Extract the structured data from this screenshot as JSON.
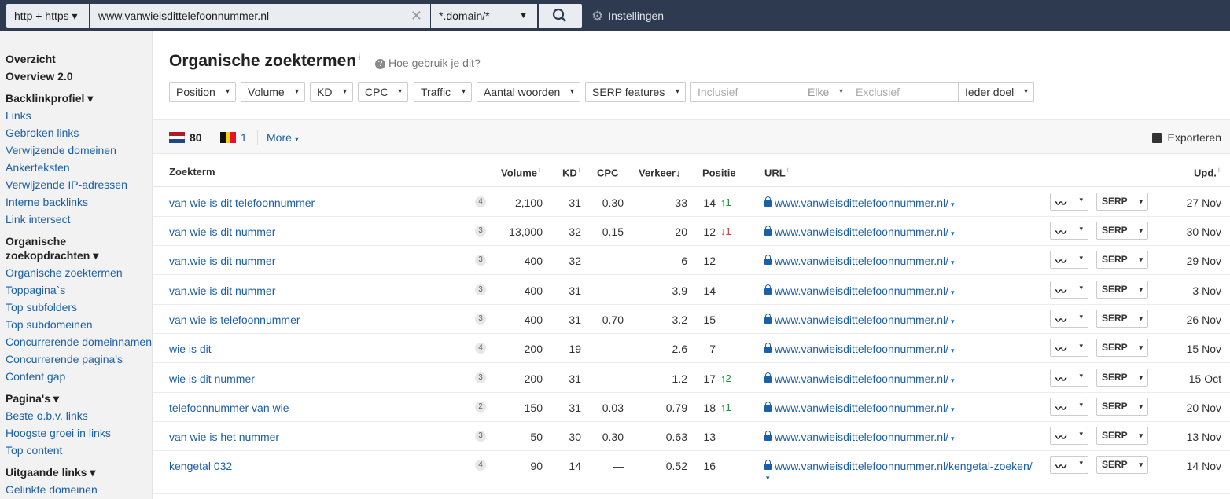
{
  "topbar": {
    "protocol": "http + https ▾",
    "url": "www.vanwieisdittelefoonnummer.nl",
    "clear": "✕",
    "mode": "*.domain/*",
    "mode_caret": "▼",
    "settings": "Instellingen"
  },
  "sidebar": {
    "overview": "Overzicht",
    "overview2": "Overview 2.0",
    "backlink_header": "Backlinkprofiel ▾",
    "backlink_items": [
      "Links",
      "Gebroken links",
      "Verwijzende domeinen",
      "Ankerteksten",
      "Verwijzende IP-adressen",
      "Interne backlinks",
      "Link intersect"
    ],
    "organic_header1": "Organische",
    "organic_header2": "zoekopdrachten ▾",
    "organic_items": [
      "Organische zoektermen",
      "Toppagina`s",
      "Top subfolders",
      "Top subdomeinen",
      "Concurrerende domeinnamen",
      "Concurrerende pagina's",
      "Content gap"
    ],
    "pages_header": "Pagina's ▾",
    "pages_items": [
      "Beste o.b.v. links",
      "Hoogste groei in links",
      "Top content"
    ],
    "outgoing_header": "Uitgaande links ▾",
    "outgoing_items": [
      "Gelinkte domeinen"
    ]
  },
  "main": {
    "title": "Organische zoektermen",
    "title_info": "i",
    "help": "Hoe gebruik je dit?",
    "help_q": "?",
    "filters": [
      "Position",
      "Volume",
      "KD",
      "CPC",
      "Traffic",
      "Aantal woorden",
      "SERP features"
    ],
    "filter_caret": "▾",
    "include_placeholder": "Inclusief",
    "include_mode": "Elke",
    "exclude_placeholder": "Exclusief",
    "target": "Ieder doel",
    "countries": [
      {
        "flag": "nl",
        "count": "80"
      },
      {
        "flag": "be",
        "count": "1"
      }
    ],
    "more": "More",
    "export": "Exporteren"
  },
  "colors": {
    "topbar": "#2e3a4f",
    "link": "#1b5fa8",
    "up": "#1a8f3c",
    "down": "#d33333"
  },
  "table": {
    "headers": {
      "keyword": "Zoekterm",
      "volume": "Volume",
      "kd": "KD",
      "cpc": "CPC",
      "traffic": "Verkeer",
      "traffic_sort": "↓",
      "position": "Positie",
      "url": "URL",
      "updated": "Upd.",
      "info": "i"
    },
    "rows": [
      {
        "keyword": "van wie is dit telefoonnummer",
        "words": "4",
        "volume": "2,100",
        "kd": "31",
        "cpc": "0.30",
        "traffic": "33",
        "position": "14",
        "change": "↑1",
        "dir": "up",
        "url": "www.vanwieisdittelefoonnummer.nl/",
        "updated": "27 Nov"
      },
      {
        "keyword": "van wie is dit nummer",
        "words": "3",
        "volume": "13,000",
        "kd": "32",
        "cpc": "0.15",
        "traffic": "20",
        "position": "12",
        "change": "↓1",
        "dir": "down",
        "url": "www.vanwieisdittelefoonnummer.nl/",
        "updated": "30 Nov"
      },
      {
        "keyword": "van.wie is dit nummer",
        "words": "3",
        "volume": "400",
        "kd": "32",
        "cpc": "—",
        "traffic": "6",
        "position": "12",
        "change": "",
        "dir": "",
        "url": "www.vanwieisdittelefoonnummer.nl/",
        "updated": "29 Nov"
      },
      {
        "keyword": "van.wie is dit nummer",
        "words": "3",
        "volume": "400",
        "kd": "31",
        "cpc": "—",
        "traffic": "3.9",
        "position": "14",
        "change": "",
        "dir": "",
        "url": "www.vanwieisdittelefoonnummer.nl/",
        "updated": "3 Nov"
      },
      {
        "keyword": "van wie is telefoonnummer",
        "words": "3",
        "volume": "400",
        "kd": "31",
        "cpc": "0.70",
        "traffic": "3.2",
        "position": "15",
        "change": "",
        "dir": "",
        "url": "www.vanwieisdittelefoonnummer.nl/",
        "updated": "26 Nov"
      },
      {
        "keyword": "wie is dit",
        "words": "4",
        "volume": "200",
        "kd": "19",
        "cpc": "—",
        "traffic": "2.6",
        "position": "7",
        "change": "",
        "dir": "",
        "url": "www.vanwieisdittelefoonnummer.nl/",
        "updated": "15 Nov"
      },
      {
        "keyword": "wie is dit nummer",
        "words": "3",
        "volume": "200",
        "kd": "31",
        "cpc": "—",
        "traffic": "1.2",
        "position": "17",
        "change": "↑2",
        "dir": "up",
        "url": "www.vanwieisdittelefoonnummer.nl/",
        "updated": "15 Oct"
      },
      {
        "keyword": "telefoonnummer van wie",
        "words": "2",
        "volume": "150",
        "kd": "31",
        "cpc": "0.03",
        "traffic": "0.79",
        "position": "18",
        "change": "↑1",
        "dir": "up",
        "url": "www.vanwieisdittelefoonnummer.nl/",
        "updated": "20 Nov"
      },
      {
        "keyword": "van wie is het nummer",
        "words": "3",
        "volume": "50",
        "kd": "30",
        "cpc": "0.30",
        "traffic": "0.63",
        "position": "13",
        "change": "",
        "dir": "",
        "url": "www.vanwieisdittelefoonnummer.nl/",
        "updated": "13 Nov"
      },
      {
        "keyword": "kengetal 032",
        "words": "4",
        "volume": "90",
        "kd": "14",
        "cpc": "—",
        "traffic": "0.52",
        "position": "16",
        "change": "",
        "dir": "",
        "url": "www.vanwieisdittelefoonnummer.nl/kengetal-zoeken/",
        "updated": "14 Nov"
      }
    ],
    "url_caret": "▾",
    "trend_label": "〰",
    "serp_label": "SERP",
    "button_caret": "▾"
  }
}
